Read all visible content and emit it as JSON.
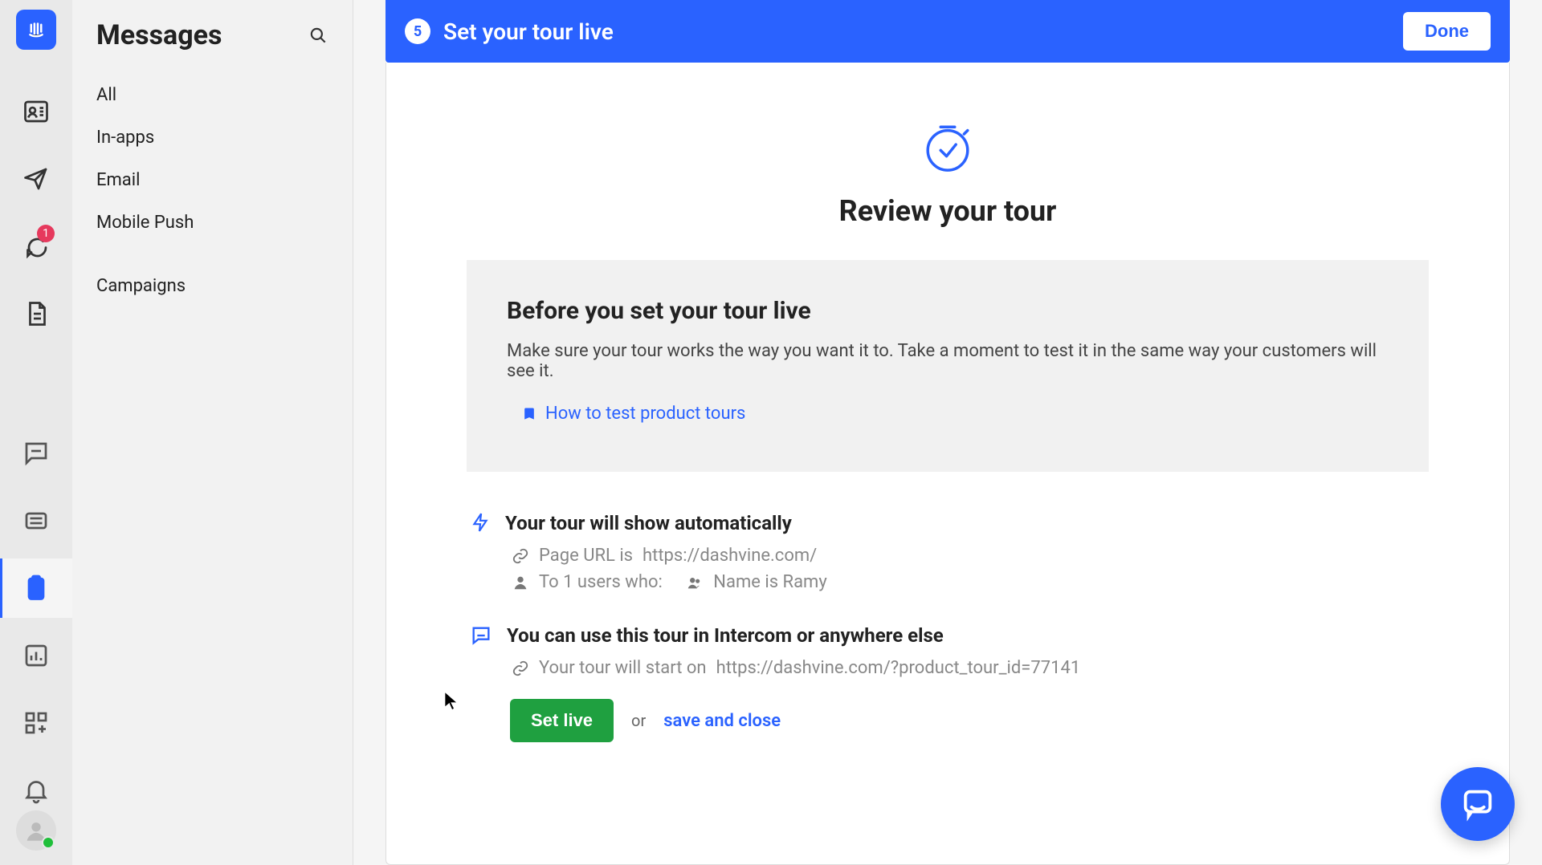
{
  "rail": {
    "conversations_badge": "1"
  },
  "sidebar": {
    "title": "Messages",
    "items": [
      "All",
      "In-apps",
      "Email",
      "Mobile Push",
      "Campaigns"
    ]
  },
  "header": {
    "step_number": "5",
    "step_title": "Set your tour live",
    "done_label": "Done"
  },
  "review": {
    "title": "Review your tour",
    "before_heading": "Before you set your tour live",
    "before_body": "Make sure your tour works the way you want it to. Take a moment to test it in the same way your customers will see it.",
    "doc_link": "How to test product tours",
    "auto": {
      "title": "Your tour will show automatically",
      "page_url_label": "Page URL is",
      "page_url": "https://dashvine.com/",
      "to_users_label": "To 1 users who:",
      "rule": "Name is Ramy"
    },
    "anywhere": {
      "title": "You can use this tour in Intercom or anywhere else",
      "starts_label": "Your tour will start on",
      "starts_url": "https://dashvine.com/?product_tour_id=77141"
    },
    "set_live_label": "Set live",
    "or_label": "or",
    "save_close_label": "save and close"
  }
}
